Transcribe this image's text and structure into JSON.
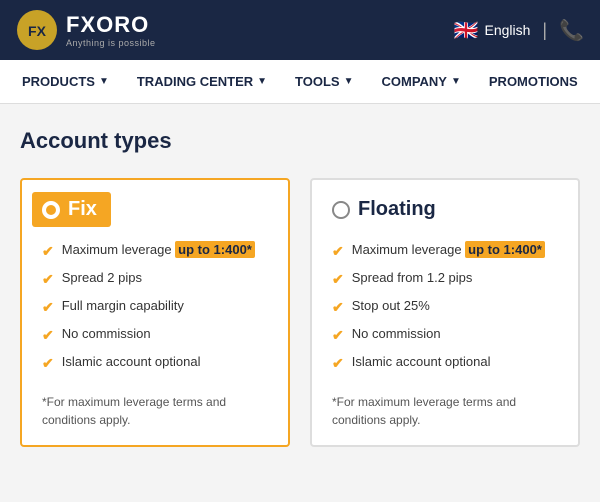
{
  "header": {
    "logo_text": "FXORO",
    "logo_tagline": "Anything is possible",
    "lang_label": "English",
    "phone_symbol": "📞"
  },
  "nav": {
    "items": [
      {
        "label": "PRODUCTS",
        "has_arrow": true
      },
      {
        "label": "TRADING CENTER",
        "has_arrow": true
      },
      {
        "label": "TOOLS",
        "has_arrow": true
      },
      {
        "label": "COMPANY",
        "has_arrow": true
      },
      {
        "label": "PROMOTIONS",
        "has_arrow": false
      }
    ]
  },
  "main": {
    "page_title": "Account types",
    "cards": [
      {
        "id": "fix",
        "title": "Fix",
        "selected": true,
        "features": [
          {
            "text_before": "Maximum leverage ",
            "highlight": "up to 1:400*",
            "text_after": ""
          },
          {
            "text_before": "Spread 2 pips",
            "highlight": "",
            "text_after": ""
          },
          {
            "text_before": "Full margin capability",
            "highlight": "",
            "text_after": ""
          },
          {
            "text_before": "No commission",
            "highlight": "",
            "text_after": ""
          },
          {
            "text_before": "Islamic account optional",
            "highlight": "",
            "text_after": ""
          }
        ],
        "footnote": "*For maximum leverage terms and conditions apply."
      },
      {
        "id": "floating",
        "title": "Floating",
        "selected": false,
        "features": [
          {
            "text_before": "Maximum leverage ",
            "highlight": "up to 1:400*",
            "text_after": ""
          },
          {
            "text_before": "Spread from 1.2 pips",
            "highlight": "",
            "text_after": ""
          },
          {
            "text_before": "Stop out 25%",
            "highlight": "",
            "text_after": ""
          },
          {
            "text_before": "No commission",
            "highlight": "",
            "text_after": ""
          },
          {
            "text_before": "Islamic account optional",
            "highlight": "",
            "text_after": ""
          }
        ],
        "footnote": "*For maximum leverage terms and conditions apply."
      }
    ]
  }
}
